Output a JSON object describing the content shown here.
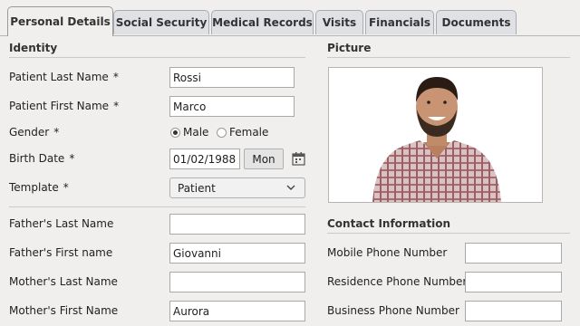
{
  "tabs": [
    {
      "label": "Personal Details",
      "active": true
    },
    {
      "label": "Social Security"
    },
    {
      "label": "Medical Records"
    },
    {
      "label": "Visits"
    },
    {
      "label": "Financials"
    },
    {
      "label": "Documents"
    }
  ],
  "identity": {
    "title": "Identity",
    "required_mark": "*",
    "last_name": {
      "label": "Patient Last Name",
      "value": "Rossi"
    },
    "first_name": {
      "label": "Patient First Name",
      "value": "Marco"
    },
    "gender": {
      "label": "Gender",
      "options": [
        "Male",
        "Female"
      ],
      "selected": "Male"
    },
    "birth_date": {
      "label": "Birth Date",
      "value": "01/02/1988",
      "weekday": "Mon"
    },
    "template": {
      "label": "Template",
      "value": "Patient"
    }
  },
  "parents": {
    "father_last": {
      "label": "Father's Last Name",
      "value": ""
    },
    "father_first": {
      "label": "Father's First name",
      "value": "Giovanni"
    },
    "mother_last": {
      "label": "Mother's Last Name",
      "value": ""
    },
    "mother_first": {
      "label": "Mother's First Name",
      "value": "Aurora"
    }
  },
  "picture": {
    "title": "Picture"
  },
  "contact": {
    "title": "Contact Information",
    "mobile": {
      "label": "Mobile Phone Number",
      "value": ""
    },
    "residence": {
      "label": "Residence Phone Number",
      "value": ""
    },
    "business": {
      "label": "Business Phone Number",
      "value": ""
    }
  },
  "icons": {
    "calendar": "calendar-icon",
    "dropdown": "chevron-down-icon"
  },
  "colors": {
    "background": "#f0efed",
    "tab_inactive": "#dfe1e4",
    "border": "#a9a9a9"
  }
}
